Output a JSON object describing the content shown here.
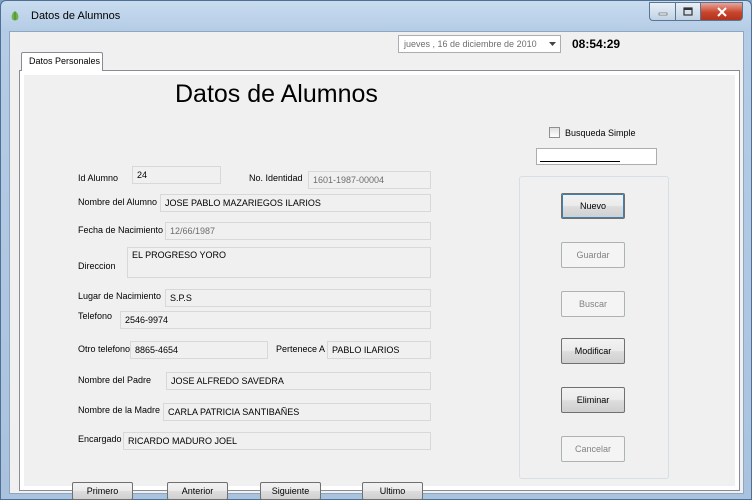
{
  "window": {
    "title": "Datos de Alumnos",
    "controls": [
      "minimize-icon",
      "maximize-icon",
      "close-icon"
    ]
  },
  "toolbar": {
    "date": "jueves , 16 de diciembre de 2010",
    "clock": "08:54:29"
  },
  "tabs": [
    {
      "label": "Datos Personales",
      "selected": true
    }
  ],
  "form": {
    "heading": "Datos de Alumnos",
    "id_alumno": {
      "label": "Id Alumno",
      "value": "24"
    },
    "no_identidad": {
      "label": "No. Identidad",
      "value": "1601-1987-00004"
    },
    "nombre_alumno": {
      "label": "Nombre del Alumno",
      "value": "JOSE PABLO MAZARIEGOS ILARIOS"
    },
    "fecha_nacimiento": {
      "label": "Fecha de Nacimiento",
      "value": "12/66/1987"
    },
    "direccion": {
      "label": "Direccion",
      "value": "EL PROGRESO YORO"
    },
    "lugar_nacimiento": {
      "label": "Lugar de Nacimiento",
      "value": "S.P.S"
    },
    "telefono": {
      "label": "Telefono",
      "value": "2546-9974"
    },
    "otro_telefono": {
      "label": "Otro telefono",
      "value": "8865-4654"
    },
    "pertenece_a": {
      "label": "Pertenece A",
      "value": "PABLO ILARIOS"
    },
    "nombre_padre": {
      "label": "Nombre del Padre",
      "value": "JOSE ALFREDO SAVEDRA"
    },
    "nombre_madre": {
      "label": "Nombre de la Madre",
      "value": "CARLA PATRICIA SANTIBAÑES"
    },
    "encargado": {
      "label": "Encargado",
      "value": "RICARDO MADURO JOEL"
    }
  },
  "navigation": {
    "first": "Primero",
    "previous": "Anterior",
    "next": "Siguiente",
    "last": "Ultimo"
  },
  "search": {
    "checkbox_label": "Busqueda Simple",
    "checked": false,
    "value": ""
  },
  "actions": {
    "new": {
      "label": "Nuevo",
      "enabled": true
    },
    "save": {
      "label": "Guardar",
      "enabled": false
    },
    "search": {
      "label": "Buscar",
      "enabled": false
    },
    "modify": {
      "label": "Modificar",
      "enabled": true
    },
    "delete": {
      "label": "Eliminar",
      "enabled": true
    },
    "cancel": {
      "label": "Cancelar",
      "enabled": false
    }
  },
  "colors": {
    "frame": "#b5cce6",
    "close_button": "#c8452c",
    "disabled_text": "#838383"
  }
}
